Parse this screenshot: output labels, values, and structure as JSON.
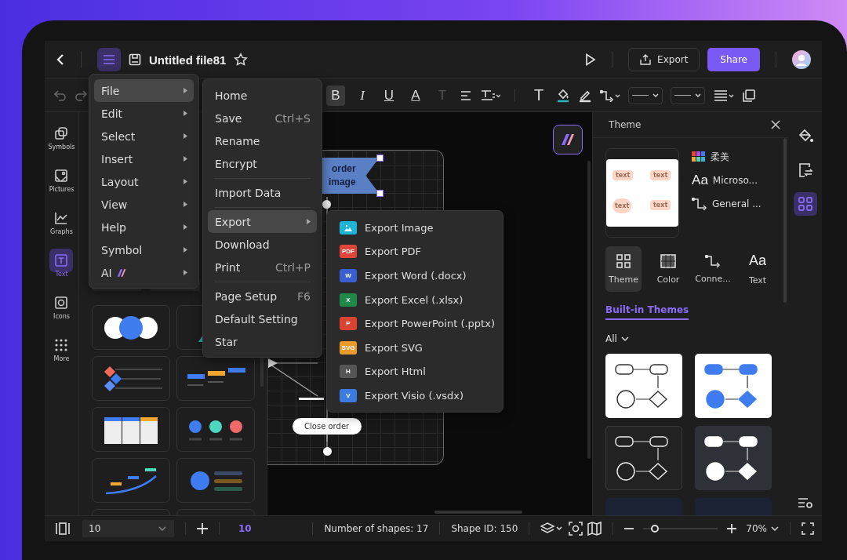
{
  "header": {
    "title": "Untitled file81",
    "starred": false,
    "export_label": "Export",
    "share_label": "Share"
  },
  "toolbar": [
    {
      "kind": "bold",
      "glyph": "B",
      "on": true,
      "disabled": false
    },
    {
      "kind": "italic",
      "glyph": "I",
      "on": false,
      "disabled": false
    },
    {
      "kind": "underline",
      "glyph": "U",
      "on": false,
      "disabled": false
    },
    {
      "kind": "font-color",
      "glyph": "A",
      "on": false,
      "disabled": false
    },
    {
      "kind": "text-plain",
      "glyph": "T",
      "on": false,
      "disabled": true
    },
    {
      "kind": "align"
    },
    {
      "kind": "spacing"
    },
    {
      "kind": "sep"
    },
    {
      "kind": "text-tool",
      "glyph": "T",
      "on": false,
      "disabled": false
    },
    {
      "kind": "fill"
    },
    {
      "kind": "pen"
    },
    {
      "kind": "connector"
    },
    {
      "kind": "line"
    },
    {
      "kind": "line"
    },
    {
      "kind": "list"
    },
    {
      "kind": "frame"
    }
  ],
  "left_rail": [
    {
      "label": "Symbols",
      "selected": false
    },
    {
      "label": "Pictures",
      "selected": false
    },
    {
      "label": "Graphs",
      "selected": false
    },
    {
      "label": "Text",
      "selected": true
    },
    {
      "label": "Icons",
      "selected": false
    },
    {
      "label": "More",
      "selected": false
    }
  ],
  "canvas": {
    "banner_lines": [
      "order",
      "image"
    ],
    "pill_text": "Close order"
  },
  "right_panel": {
    "title": "Theme",
    "preview_labels": [
      "text",
      "text",
      "text",
      "text"
    ],
    "theme_name": "柔美",
    "font_glyph": "Aa",
    "font_name": "Microso...",
    "connector_name": "General ...",
    "tabs": [
      {
        "label": "Theme",
        "selected": true
      },
      {
        "label": "Color",
        "selected": false
      },
      {
        "label": "Conne...",
        "selected": false
      },
      {
        "label": "Text",
        "selected": false,
        "glyph": "Aa"
      }
    ],
    "section_tab": "Built-in Themes",
    "filter": "All",
    "themes": [
      {
        "kind": "light-outline"
      },
      {
        "kind": "light-filled"
      },
      {
        "kind": "dark-outline"
      },
      {
        "kind": "dark-filled"
      },
      {
        "kind": "navy"
      },
      {
        "kind": "navy"
      }
    ]
  },
  "main_menu": [
    {
      "label": "File",
      "selected": true,
      "ai": false
    },
    {
      "label": "Edit",
      "selected": false,
      "ai": false
    },
    {
      "label": "Select",
      "selected": false,
      "ai": false
    },
    {
      "label": "Insert",
      "selected": false,
      "ai": false
    },
    {
      "label": "Layout",
      "selected": false,
      "ai": false
    },
    {
      "label": "View",
      "selected": false,
      "ai": false
    },
    {
      "label": "Help",
      "selected": false,
      "ai": false
    },
    {
      "label": "Symbol",
      "selected": false,
      "ai": false
    },
    {
      "label": "AI",
      "selected": false,
      "ai": true
    }
  ],
  "file_menu": [
    {
      "kind": "item",
      "label": "Home",
      "selected": false
    },
    {
      "kind": "item",
      "label": "Save",
      "shortcut": "Ctrl+S",
      "selected": false
    },
    {
      "kind": "item",
      "label": "Rename",
      "selected": false
    },
    {
      "kind": "item",
      "label": "Encrypt",
      "selected": false
    },
    {
      "kind": "divider"
    },
    {
      "kind": "item",
      "label": "Import Data",
      "selected": false
    },
    {
      "kind": "divider"
    },
    {
      "kind": "submenu",
      "label": "Export",
      "selected": true
    },
    {
      "kind": "item",
      "label": "Download",
      "selected": false
    },
    {
      "kind": "item",
      "label": "Print",
      "shortcut": "Ctrl+P",
      "selected": false
    },
    {
      "kind": "divider"
    },
    {
      "kind": "item",
      "label": "Page Setup",
      "shortcut": "F6",
      "selected": false
    },
    {
      "kind": "item",
      "label": "Default Setting",
      "selected": false
    },
    {
      "kind": "item",
      "label": "Star",
      "selected": false
    }
  ],
  "export_menu": [
    {
      "label": "Export Image",
      "color": "#1fb5d6"
    },
    {
      "label": "Export PDF",
      "badge": "PDF",
      "color": "#e0453a"
    },
    {
      "label": "Export Word (.docx)",
      "badge": "W",
      "color": "#3a5fd0"
    },
    {
      "label": "Export Excel (.xlsx)",
      "badge": "X",
      "color": "#1e8a4a"
    },
    {
      "label": "Export PowerPoint (.pptx)",
      "badge": "P",
      "color": "#d9432f"
    },
    {
      "label": "Export SVG",
      "badge": "SVG",
      "color": "#e89a2c"
    },
    {
      "label": "Export Html",
      "badge": "H",
      "color": "#555555"
    },
    {
      "label": "Export Visio (.vsdx)",
      "badge": "V",
      "color": "#3c7be0"
    }
  ],
  "status_bar": {
    "page_select": "10",
    "page_number": "10",
    "shape_count": "Number of shapes: 17",
    "shape_id": "Shape ID: 150",
    "zoom": "70%",
    "level": 0.1
  }
}
